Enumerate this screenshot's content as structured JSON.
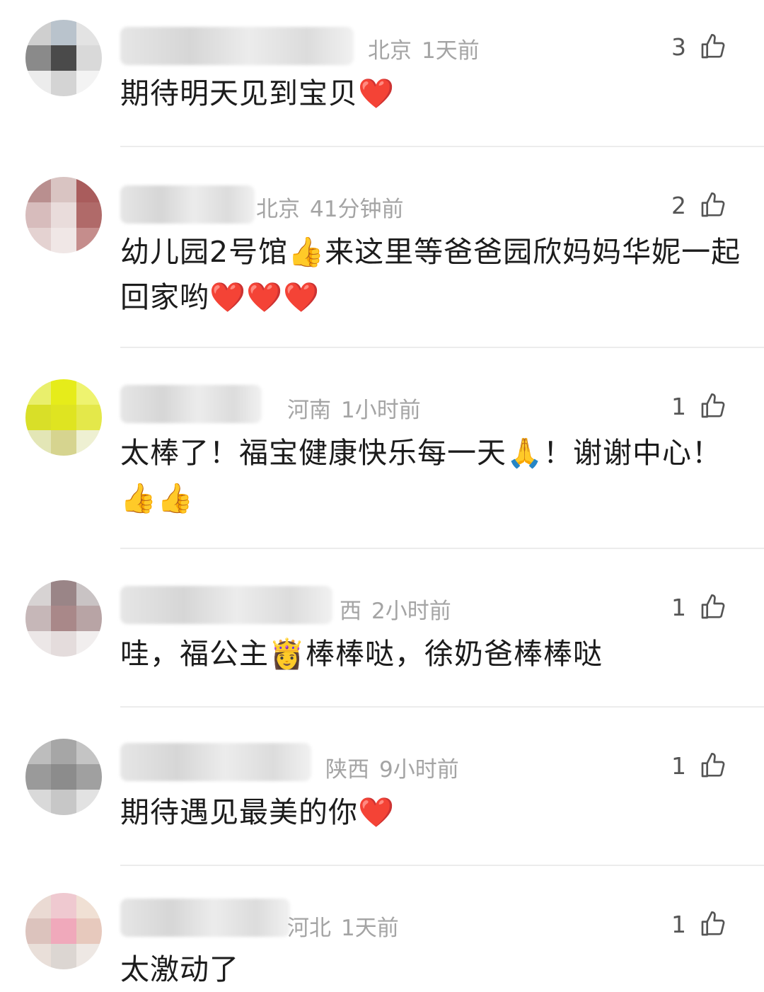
{
  "comments": [
    {
      "location": "北京",
      "time": "1天前",
      "likes": "3",
      "text": "期待明天见到宝贝❤️"
    },
    {
      "location": "北京",
      "time": "41分钟前",
      "likes": "2",
      "text": "幼儿园2号馆👍来这里等爸爸园欣妈妈华妮一起回家哟❤️❤️❤️"
    },
    {
      "location": "河南",
      "time": "1小时前",
      "likes": "1",
      "text": "太棒了！福宝健康快乐每一天🙏！谢谢中心！👍👍"
    },
    {
      "location": "西",
      "time": "2小时前",
      "likes": "1",
      "text": "哇，福公主👸棒棒哒，徐奶爸棒棒哒"
    },
    {
      "location": "陕西",
      "time": "9小时前",
      "likes": "1",
      "text": "期待遇见最美的你❤️"
    },
    {
      "location": "河北",
      "time": "1天前",
      "likes": "1",
      "text": "太激动了"
    }
  ],
  "icons": {
    "like": "thumbs-up-outline-icon"
  }
}
